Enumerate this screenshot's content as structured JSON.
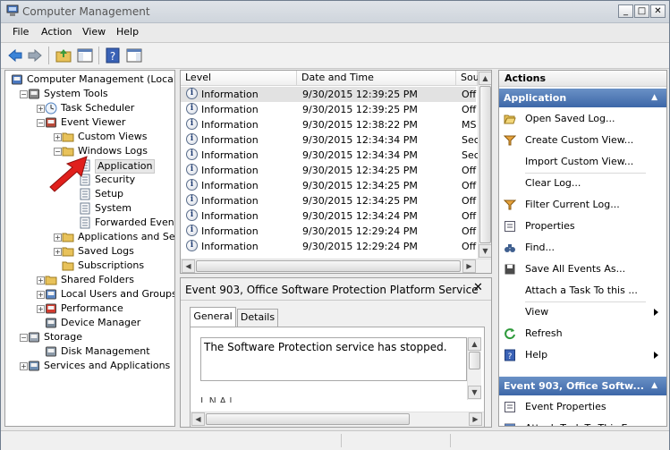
{
  "window": {
    "title": "Computer Management"
  },
  "menu": [
    "File",
    "Action",
    "View",
    "Help"
  ],
  "tree": [
    {
      "label": "Computer Management (Local)",
      "icon": "computer-icon",
      "depth": 0,
      "expander": ""
    },
    {
      "label": "System Tools",
      "icon": "tools-icon",
      "depth": 1,
      "expander": "-"
    },
    {
      "label": "Task Scheduler",
      "icon": "clock-icon",
      "depth": 2,
      "expander": "+"
    },
    {
      "label": "Event Viewer",
      "icon": "event-viewer-icon",
      "depth": 2,
      "expander": "-"
    },
    {
      "label": "Custom Views",
      "icon": "folder-icon",
      "depth": 3,
      "expander": "+"
    },
    {
      "label": "Windows Logs",
      "icon": "folder-icon",
      "depth": 3,
      "expander": "-"
    },
    {
      "label": "Application",
      "icon": "log-icon",
      "depth": 4,
      "expander": "",
      "selected": true
    },
    {
      "label": "Security",
      "icon": "log-icon",
      "depth": 4,
      "expander": ""
    },
    {
      "label": "Setup",
      "icon": "log-icon",
      "depth": 4,
      "expander": ""
    },
    {
      "label": "System",
      "icon": "log-icon",
      "depth": 4,
      "expander": ""
    },
    {
      "label": "Forwarded Events",
      "icon": "log-icon",
      "depth": 4,
      "expander": ""
    },
    {
      "label": "Applications and Servi",
      "icon": "folder-icon",
      "depth": 3,
      "expander": "+"
    },
    {
      "label": "Saved Logs",
      "icon": "folder-icon",
      "depth": 3,
      "expander": "+"
    },
    {
      "label": "Subscriptions",
      "icon": "folder-icon",
      "depth": 3,
      "expander": ""
    },
    {
      "label": "Shared Folders",
      "icon": "shared-folder-icon",
      "depth": 2,
      "expander": "+"
    },
    {
      "label": "Local Users and Groups",
      "icon": "users-icon",
      "depth": 2,
      "expander": "+"
    },
    {
      "label": "Performance",
      "icon": "performance-icon",
      "depth": 2,
      "expander": "+"
    },
    {
      "label": "Device Manager",
      "icon": "device-manager-icon",
      "depth": 2,
      "expander": ""
    },
    {
      "label": "Storage",
      "icon": "storage-icon",
      "depth": 1,
      "expander": "-"
    },
    {
      "label": "Disk Management",
      "icon": "disk-icon",
      "depth": 2,
      "expander": ""
    },
    {
      "label": "Services and Applications",
      "icon": "services-icon",
      "depth": 1,
      "expander": "+"
    }
  ],
  "events": {
    "columns": [
      "Level",
      "Date and Time",
      "Sou"
    ],
    "rows": [
      {
        "level": "Information",
        "datetime": "9/30/2015 12:39:25 PM",
        "source": "Off",
        "selected": true
      },
      {
        "level": "Information",
        "datetime": "9/30/2015 12:39:25 PM",
        "source": "Off"
      },
      {
        "level": "Information",
        "datetime": "9/30/2015 12:38:22 PM",
        "source": "MS"
      },
      {
        "level": "Information",
        "datetime": "9/30/2015 12:34:34 PM",
        "source": "Sec"
      },
      {
        "level": "Information",
        "datetime": "9/30/2015 12:34:34 PM",
        "source": "Sec"
      },
      {
        "level": "Information",
        "datetime": "9/30/2015 12:34:25 PM",
        "source": "Off"
      },
      {
        "level": "Information",
        "datetime": "9/30/2015 12:34:25 PM",
        "source": "Off"
      },
      {
        "level": "Information",
        "datetime": "9/30/2015 12:34:25 PM",
        "source": "Off"
      },
      {
        "level": "Information",
        "datetime": "9/30/2015 12:34:24 PM",
        "source": "Off"
      },
      {
        "level": "Information",
        "datetime": "9/30/2015 12:29:24 PM",
        "source": "Off"
      },
      {
        "level": "Information",
        "datetime": "9/30/2015 12:29:24 PM",
        "source": "Off"
      }
    ]
  },
  "detail": {
    "title": "Event 903, Office Software Protection Platform Service",
    "tabs": [
      "General",
      "Details"
    ],
    "message": "The Software Protection service has stopped.",
    "partial_row": "L    N              A     l"
  },
  "actions": {
    "title": "Actions",
    "section1": "Application",
    "items1": [
      {
        "label": "Open Saved Log...",
        "icon": "open-folder-icon"
      },
      {
        "label": "Create Custom View...",
        "icon": "filter-icon"
      },
      {
        "label": "Import Custom View...",
        "icon": ""
      },
      {
        "label": "Clear Log...",
        "icon": ""
      },
      {
        "label": "Filter Current Log...",
        "icon": "filter-icon"
      },
      {
        "label": "Properties",
        "icon": "properties-icon"
      },
      {
        "label": "Find...",
        "icon": "binoculars-icon"
      },
      {
        "label": "Save All Events As...",
        "icon": "save-icon"
      },
      {
        "label": "Attach a Task To this ...",
        "icon": ""
      },
      {
        "label": "View",
        "icon": "",
        "submenu": true
      },
      {
        "label": "Refresh",
        "icon": "refresh-icon"
      },
      {
        "label": "Help",
        "icon": "help-icon",
        "submenu": true
      }
    ],
    "section2": "Event 903, Office Softw...",
    "items2": [
      {
        "label": "Event Properties",
        "icon": "properties-icon"
      },
      {
        "label": "Attach Task To This E...",
        "icon": "task-icon"
      }
    ]
  },
  "colors": {
    "accent": "#3d67a8",
    "arrow": "#e0201c"
  }
}
